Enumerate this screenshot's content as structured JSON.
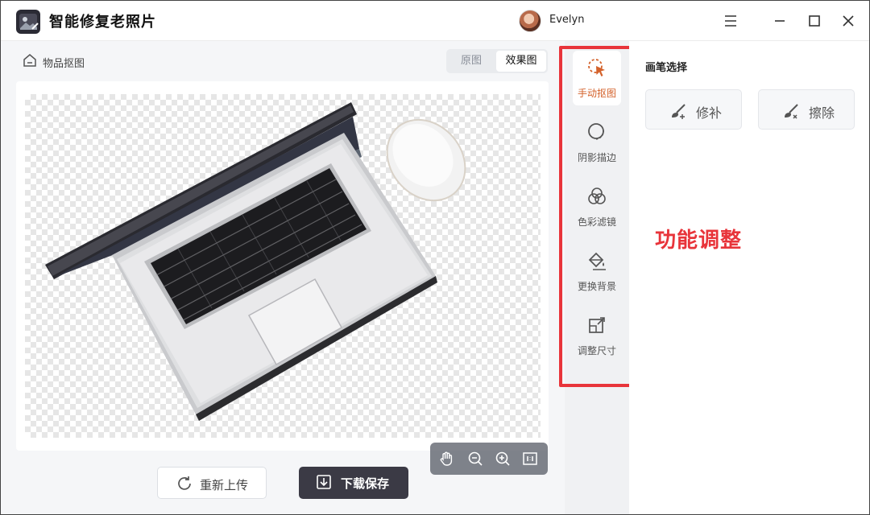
{
  "app": {
    "title": "智能修复老照片",
    "user_name": "Evelyn"
  },
  "breadcrumb": {
    "label": "物品抠图"
  },
  "view_toggle": {
    "original": "原图",
    "effect": "效果图",
    "selected": "效果图"
  },
  "canvas": {
    "content": "laptop-and-mouse-cutout",
    "background": "transparent-checkerboard"
  },
  "zoom_controls": [
    {
      "icon": "hand-icon"
    },
    {
      "icon": "zoom-out-icon"
    },
    {
      "icon": "zoom-in-icon"
    },
    {
      "icon": "fit-1to1-icon"
    }
  ],
  "actions": {
    "reupload": "重新上传",
    "download": "下载保存"
  },
  "tools": [
    {
      "label": "手动抠图",
      "icon": "cursor-lasso-icon",
      "active": true
    },
    {
      "label": "阴影描边",
      "icon": "shadow-outline-icon",
      "active": false
    },
    {
      "label": "色彩滤镜",
      "icon": "color-filter-icon",
      "active": false
    },
    {
      "label": "更换背景",
      "icon": "paint-bucket-icon",
      "active": false
    },
    {
      "label": "调整尺寸",
      "icon": "resize-icon",
      "active": false
    }
  ],
  "brush": {
    "title": "画笔选择",
    "repair": "修补",
    "erase": "擦除"
  },
  "annotation": "功能调整",
  "colors": {
    "accent": "#d4622b",
    "highlight": "#e8343a",
    "dark_button": "#3b3a45"
  }
}
